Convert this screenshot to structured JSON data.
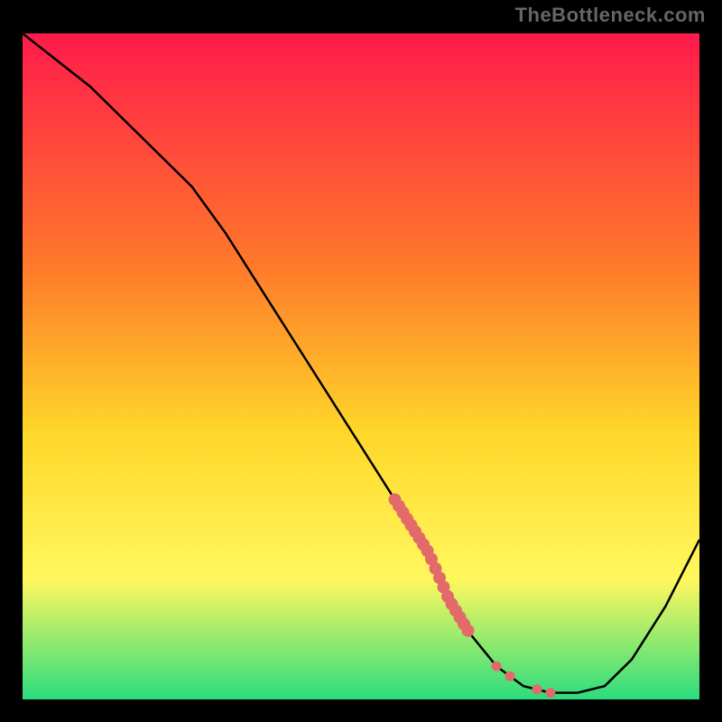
{
  "watermark": "TheBottleneck.com",
  "colors": {
    "bg": "#000000",
    "grad_top": "#ff1a4b",
    "grad_mid1": "#ff7a2a",
    "grad_mid2": "#ffd72a",
    "grad_mid3": "#fff85e",
    "grad_bot": "#2bdc7e",
    "line": "#000000",
    "marker": "#e26a6a"
  },
  "chart_data": {
    "type": "line",
    "title": "",
    "xlabel": "",
    "ylabel": "",
    "xlim": [
      0,
      100
    ],
    "ylim": [
      0,
      100
    ],
    "x": [
      0,
      5,
      10,
      15,
      20,
      25,
      30,
      35,
      40,
      45,
      50,
      55,
      60,
      63,
      66,
      70,
      74,
      78,
      82,
      86,
      90,
      95,
      100
    ],
    "y": [
      100,
      96,
      92,
      87,
      82,
      77,
      70,
      62,
      54,
      46,
      38,
      30,
      22,
      15,
      10,
      5,
      2,
      1,
      1,
      2,
      6,
      14,
      24
    ],
    "markers": {
      "segment_start_x": 55,
      "segment_end_x": 66,
      "extra_points_x": [
        70,
        72,
        76,
        78
      ]
    }
  }
}
